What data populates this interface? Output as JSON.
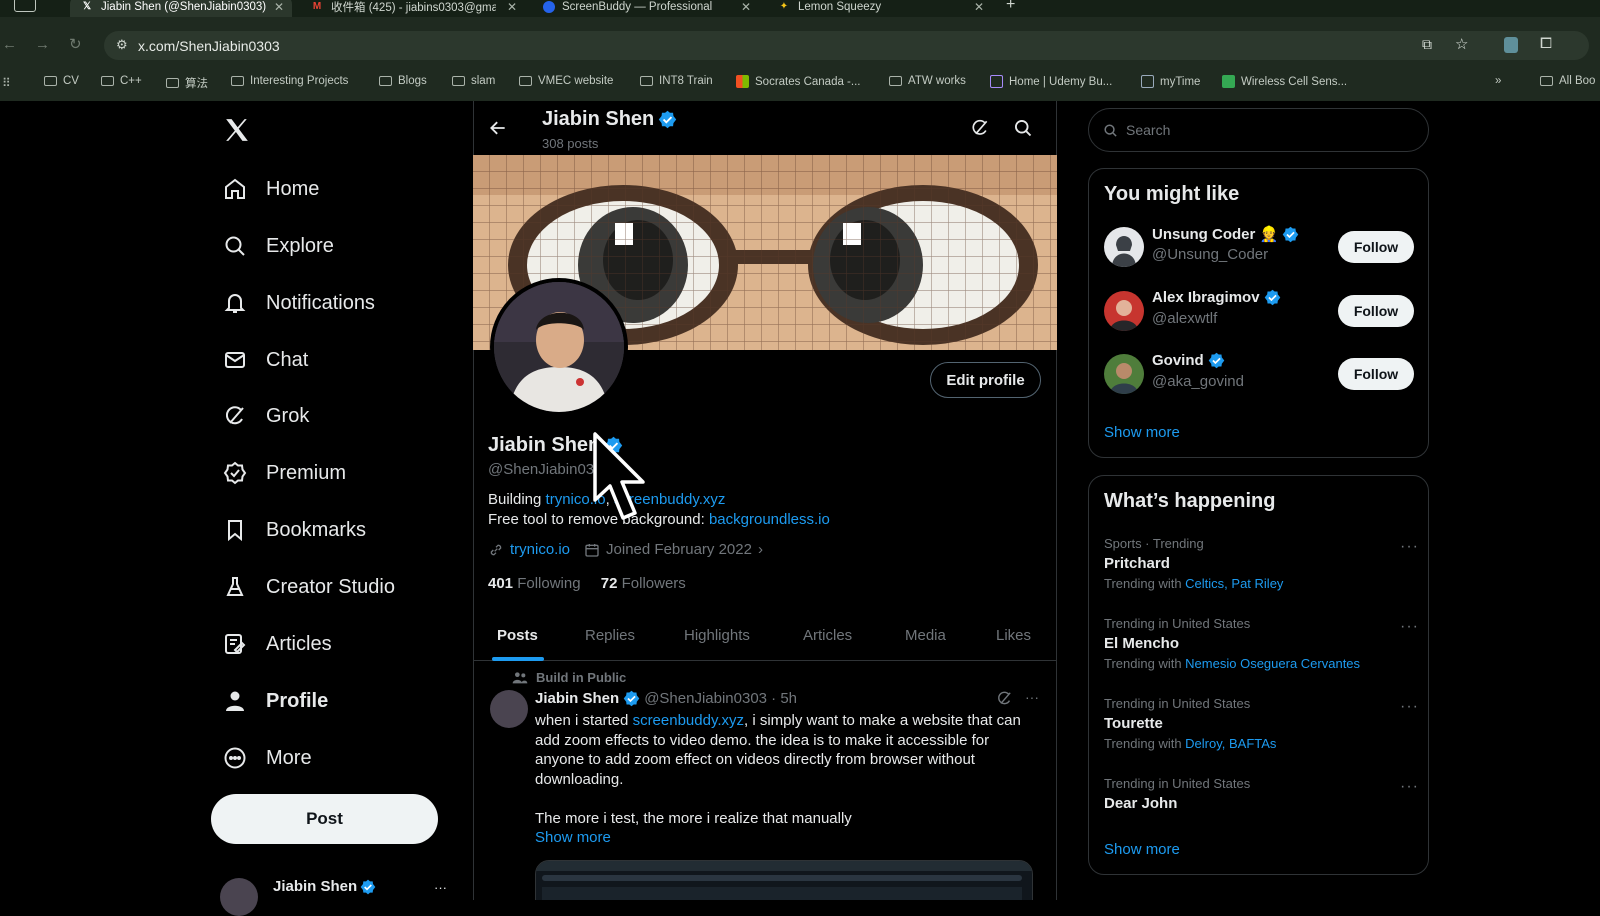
{
  "browser": {
    "tabs": [
      {
        "title": "Jiabin Shen (@ShenJiabin0303)",
        "icon": "x-logo-icon"
      },
      {
        "title": "收件箱 (425) - jiabins0303@gmail.com",
        "icon": "gmail-icon"
      },
      {
        "title": "ScreenBuddy — Professional",
        "icon": "screenbuddy-icon"
      },
      {
        "title": "Lemon Squeezy",
        "icon": "lemon-icon"
      }
    ],
    "new_tab": "+",
    "url": "x.com/ShenJiabin0303",
    "bookmarks": [
      "CV",
      "C++",
      "算法",
      "Interesting Projects",
      "Blogs",
      "slam",
      "VMEC website",
      "INT8 Train",
      "Socrates Canada -...",
      "ATW works",
      "Home | Udemy Bu...",
      "myTime",
      "Wireless Cell Sens..."
    ],
    "bookmarks_overflow": "»",
    "all_bookmarks": "All Boo"
  },
  "sidebar": {
    "items": [
      {
        "label": "Home",
        "icon": "home-icon"
      },
      {
        "label": "Explore",
        "icon": "search-icon"
      },
      {
        "label": "Notifications",
        "icon": "bell-icon"
      },
      {
        "label": "Chat",
        "icon": "mail-icon"
      },
      {
        "label": "Grok",
        "icon": "grok-icon"
      },
      {
        "label": "Premium",
        "icon": "premium-badge-icon"
      },
      {
        "label": "Bookmarks",
        "icon": "bookmark-icon"
      },
      {
        "label": "Creator Studio",
        "icon": "flask-icon"
      },
      {
        "label": "Articles",
        "icon": "articles-icon"
      },
      {
        "label": "Profile",
        "icon": "person-icon"
      },
      {
        "label": "More",
        "icon": "more-circle-icon"
      }
    ],
    "post_label": "Post",
    "account_name": "Jiabin Shen",
    "account_more": "···"
  },
  "header": {
    "name": "Jiabin Shen",
    "posts": "308 posts"
  },
  "profile": {
    "edit_label": "Edit profile",
    "name": "Jiabin Shen",
    "handle": "@ShenJiabin0303",
    "bio_line1_prefix": "Building ",
    "bio_link1": "trynico.io",
    "bio_sep": ", ",
    "bio_link2": "screenbuddy.xyz",
    "bio_line2_prefix": "Free tool to remove background: ",
    "bio_link3": "backgroundless.io",
    "website": "trynico.io",
    "joined": "Joined February 2022",
    "following_count": "401",
    "following_label": "Following",
    "followers_count": "72",
    "followers_label": "Followers"
  },
  "profile_tabs": [
    "Posts",
    "Replies",
    "Highlights",
    "Articles",
    "Media",
    "Likes"
  ],
  "post": {
    "context": "Build in Public",
    "author": "Jiabin Shen",
    "handle": "@ShenJiabin0303 · 5h",
    "more": "···",
    "text1_prefix": "when i started ",
    "text1_link": "screenbuddy.xyz",
    "text1_rest": ", i simply want to make a website that can add zoom effects to video demo. the idea is to make it accessible for anyone to add zoom effect on videos directly from browser without downloading.",
    "text2": "The more i test, the more i realize that manually",
    "show_more": "Show more"
  },
  "right": {
    "search_placeholder": "Search",
    "might_like_title": "You might like",
    "suggestions": [
      {
        "name": "Unsung Coder 👷",
        "handle": "@Unsung_Coder",
        "follow": "Follow"
      },
      {
        "name": "Alex Ibragimov",
        "handle": "@alexwtlf",
        "follow": "Follow"
      },
      {
        "name": "Govind",
        "handle": "@aka_govind",
        "follow": "Follow"
      }
    ],
    "show_more": "Show more",
    "happening_title": "What’s happening",
    "trends": [
      {
        "context": "Sports · Trending",
        "title": "Pritchard",
        "with_label": "Trending with ",
        "with": "Celtics, Pat Riley"
      },
      {
        "context": "Trending in United States",
        "title": "El Mencho",
        "with_label": "Trending with ",
        "with": "Nemesio Oseguera Cervantes"
      },
      {
        "context": "Trending in United States",
        "title": "Tourette",
        "with_label": "Trending with ",
        "with": "Delroy, BAFTAs"
      },
      {
        "context": "Trending in United States",
        "title": "Dear John",
        "with_label": "",
        "with": ""
      }
    ],
    "trend_more": "···",
    "happening_show_more": "Show more"
  },
  "colors": {
    "accent": "#1d9bf0",
    "background": "#000000",
    "border": "#2f3336",
    "muted": "#71767b"
  }
}
